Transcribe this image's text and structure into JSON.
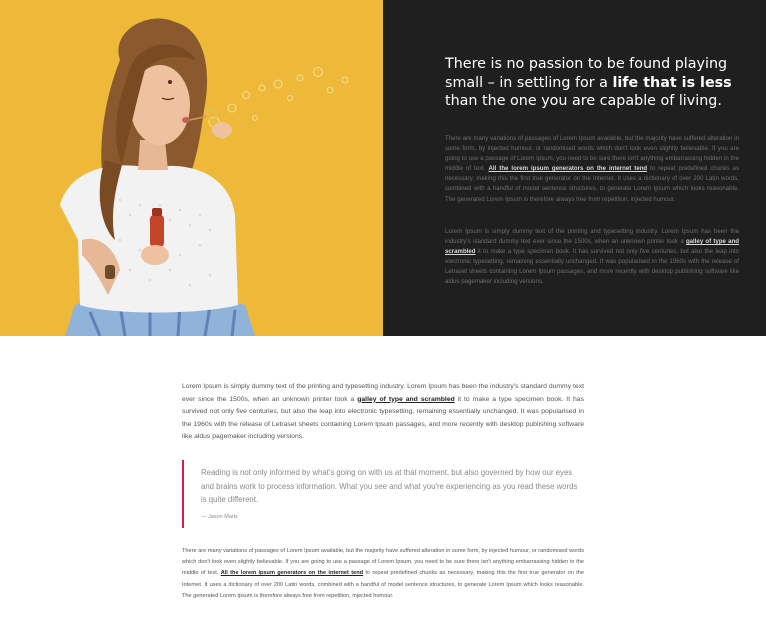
{
  "hero": {
    "quote_pre": "There is no passion to be found playing small – in settling for a ",
    "quote_bold": "life that is less",
    "quote_post": " than the one you are capable of living.",
    "p1_a": "There are many variations of passages of Lorem Ipsum available, but the majority have suffered alteration in some form, by injected humour, or randomised words which don't look even slightly believable. If you are going to use a passage of Lorem Ipsum, you need to be sure there isn't anything embarrassing hidden in the middle of text. ",
    "p1_link": "All the lorem ipsum generators on the internet tend",
    "p1_b": " to repeat predefined chunks as necessary, making this the first true generator on the Internet. It uses a dictionary of over 200 Latin words, combined with a handful of model sentence structures, to generate Lorem Ipsum which looks reasonable. The generated Lorem Ipsum is therefore always free from repetition, injected humour.",
    "p2_a": "Lorem Ipsum is simply dummy text of the printing and typesetting industry. Lorem Ipsum has been the industry's standard dummy text ever since the 1500s, when an unknown printer took a ",
    "p2_link": "galley of type and scrambled",
    "p2_b": " it to make a type specimen book. It has survived not only five centuries, but also the leap into electronic typesetting, remaining essentially unchanged. It was popularised in the 1960s with the release of Letraset sheets containing Lorem Ipsum passages, and more recently with desktop publishing software like aldus pagemaker including versions."
  },
  "article": {
    "p1_a": "Lorem Ipsum is simply dummy text of the printing and typesetting industry. Lorem Ipsum has been the industry's standard dummy text ever since the 1500s, when an unknown printer took a ",
    "p1_link": "galley of type and scrambled",
    "p1_b": " it to make a type specimen book. It has survived not only five centuries, but also the leap into electronic typesetting, remaining essentially unchanged. It was popularised in the 1960s with the release of Letraset sheets containing Lorem Ipsum passages, and more recently with desktop publishing software like aldus pagemaker including versions.",
    "blockquote": "Reading is not only informed by what's going on with us at that moment, but also governed by how our eyes and brains work to process information. What you see and what you're experiencing as you read these words is quite different.",
    "cite": "— Jason Maris",
    "p2_a": "There are many variations of passages of Lorem Ipsum available, but the majority have suffered alteration in some form, by injected humour, or randomised words which don't look even slightly believable. If you are going to use a passage of Lorem Ipsum, you need to be sure there isn't anything embarrassing hidden in the middle of text. ",
    "p2_link": "All the lorem ipsum generators on the internet tend",
    "p2_b": " to repeat predefined chunks as necessary, making this the first true generator on the Internet. It uses a dictionary of over 200 Latin words, combined with a handful of model sentence structures, to generate Lorem Ipsum which looks reasonable. The generated Lorem Ipsum is therefore always free from repetition, injected humour."
  },
  "colors": {
    "yellow_bg": "#f1bd3b",
    "dark_bg": "#1f1f1f",
    "accent_red": "#d61f3d"
  },
  "photo": {
    "icon": "woman-blowing-bubbles-photo"
  }
}
